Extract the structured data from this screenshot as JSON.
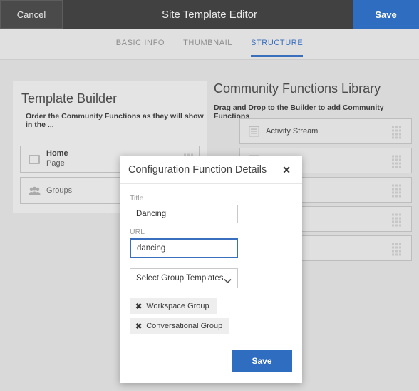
{
  "topbar": {
    "cancel_label": "Cancel",
    "title": "Site Template Editor",
    "save_label": "Save",
    "bg_color": "#414141",
    "accent_color": "#2f6dc0"
  },
  "tabs": [
    {
      "label": "BASIC INFO",
      "active": false
    },
    {
      "label": "THUMBNAIL",
      "active": false
    },
    {
      "label": "STRUCTURE",
      "active": true
    }
  ],
  "builder": {
    "title": "Template Builder",
    "subtitle": "Order the Community Functions as they will show in the ...",
    "rows": [
      {
        "icon": "page-icon",
        "line1": "Home",
        "line2": "Page"
      },
      {
        "icon": "groups-icon",
        "line1": "Groups",
        "line2": ""
      }
    ]
  },
  "library": {
    "title": "Community Functions Library",
    "subtitle": "Drag and Drop to the Builder to add Community Functions",
    "rows": [
      {
        "icon": "list-icon",
        "label": "Activity Stream",
        "handle": "drag-handle-icon"
      },
      {
        "icon": "list-icon",
        "label": "",
        "handle": "drag-handle-icon"
      },
      {
        "icon": "list-icon",
        "label": "",
        "handle": "drag-handle-icon"
      },
      {
        "icon": "list-icon",
        "label": "",
        "handle": "drag-handle-icon"
      },
      {
        "icon": "list-icon",
        "label": "",
        "handle": "drag-handle-icon"
      }
    ]
  },
  "modal": {
    "title": "Configuration Function Details",
    "close_label": "✕",
    "title_field": {
      "label": "Title",
      "value": "Dancing",
      "placeholder": ""
    },
    "url_field": {
      "label": "URL",
      "value": "dancing",
      "placeholder": "",
      "focused": true
    },
    "group_select": {
      "value": "Select Group Templates",
      "chevron": "chevron-down-icon"
    },
    "tags": [
      {
        "remove": "✖",
        "label": "Workspace Group"
      },
      {
        "remove": "✖",
        "label": "Conversational Group"
      }
    ],
    "save_label": "Save"
  }
}
